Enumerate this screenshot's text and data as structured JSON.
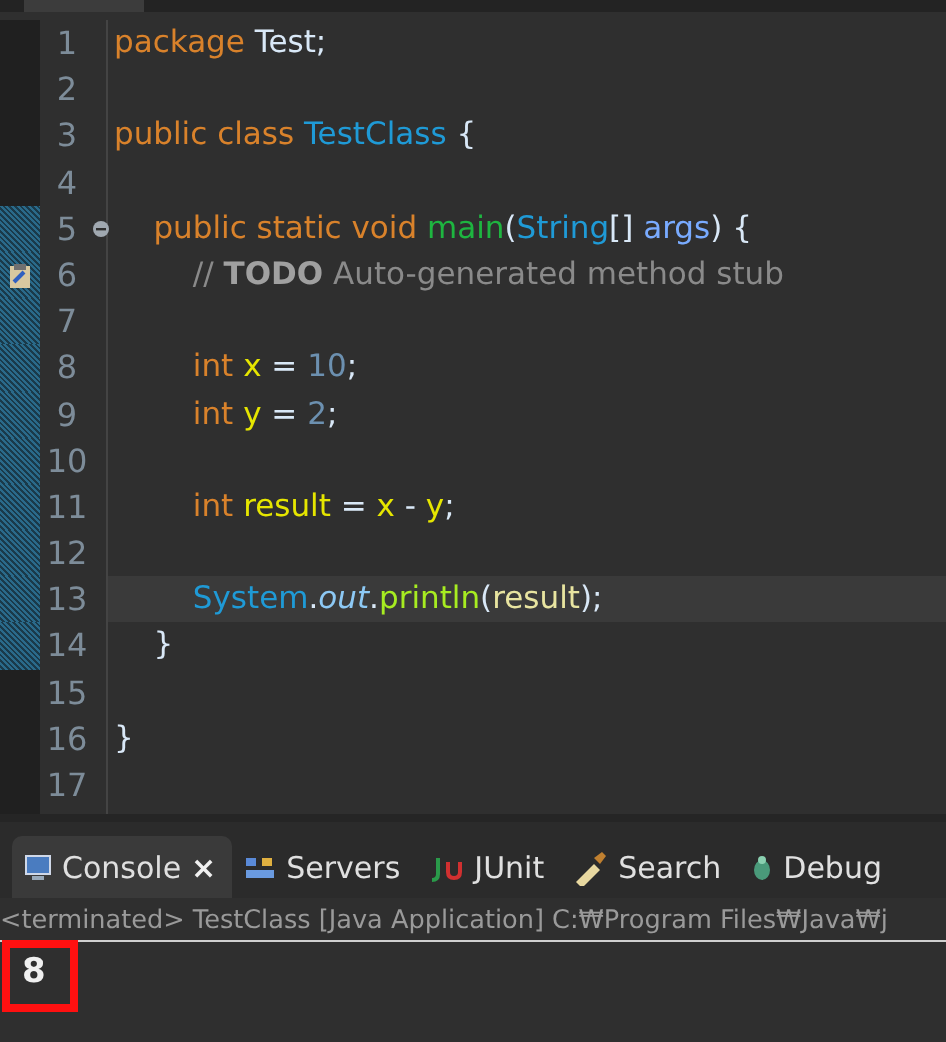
{
  "editor": {
    "lines": [
      {
        "number": "1",
        "tokens": [
          {
            "text": "package ",
            "kind": "keyword"
          },
          {
            "text": "Test;",
            "kind": "plain"
          }
        ]
      },
      {
        "number": "2"
      },
      {
        "number": "3",
        "tokens": [
          {
            "text": "public class ",
            "kind": "keyword"
          },
          {
            "text": "TestClass",
            "kind": "type"
          },
          {
            "text": " {",
            "kind": "plain"
          }
        ]
      },
      {
        "number": "4"
      },
      {
        "number": "5",
        "in_range": true,
        "fold": true,
        "tokens": [
          {
            "text": "    public static void ",
            "kind": "keyword"
          },
          {
            "text": "main",
            "kind": "method"
          },
          {
            "text": "(",
            "kind": "plain"
          },
          {
            "text": "String",
            "kind": "type"
          },
          {
            "text": "[] ",
            "kind": "plain"
          },
          {
            "text": "args",
            "kind": "param"
          },
          {
            "text": ") {",
            "kind": "plain"
          }
        ]
      },
      {
        "number": "6",
        "in_range": true,
        "annotation": true,
        "tokens": [
          {
            "text": "        // ",
            "kind": "comment"
          },
          {
            "text": "TODO",
            "kind": "todo"
          },
          {
            "text": " Auto-generated method stub",
            "kind": "comment"
          }
        ]
      },
      {
        "number": "7",
        "in_range": true
      },
      {
        "number": "8",
        "in_range": true,
        "tokens": [
          {
            "text": "        int ",
            "kind": "keyword"
          },
          {
            "text": "x",
            "kind": "local"
          },
          {
            "text": " = ",
            "kind": "plain"
          },
          {
            "text": "10",
            "kind": "number"
          },
          {
            "text": ";",
            "kind": "plain"
          }
        ]
      },
      {
        "number": "9",
        "in_range": true,
        "tokens": [
          {
            "text": "        int ",
            "kind": "keyword"
          },
          {
            "text": "y",
            "kind": "local"
          },
          {
            "text": " = ",
            "kind": "plain"
          },
          {
            "text": "2",
            "kind": "number"
          },
          {
            "text": ";",
            "kind": "plain"
          }
        ]
      },
      {
        "number": "10",
        "in_range": true
      },
      {
        "number": "11",
        "in_range": true,
        "tokens": [
          {
            "text": "        int ",
            "kind": "keyword"
          },
          {
            "text": "result",
            "kind": "local"
          },
          {
            "text": " = ",
            "kind": "plain"
          },
          {
            "text": "x",
            "kind": "local"
          },
          {
            "text": " - ",
            "kind": "plain"
          },
          {
            "text": "y",
            "kind": "local"
          },
          {
            "text": ";",
            "kind": "plain"
          }
        ]
      },
      {
        "number": "12",
        "in_range": true
      },
      {
        "number": "13",
        "current": true,
        "in_range": true,
        "tokens": [
          {
            "text": "        System",
            "kind": "type"
          },
          {
            "text": ".",
            "kind": "plain"
          },
          {
            "text": "out",
            "kind": "field"
          },
          {
            "text": ".",
            "kind": "plain"
          },
          {
            "text": "println",
            "kind": "call"
          },
          {
            "text": "(",
            "kind": "plain"
          },
          {
            "text": "result",
            "kind": "arg"
          },
          {
            "text": ");",
            "kind": "plain"
          }
        ]
      },
      {
        "number": "14",
        "in_range": true,
        "tokens": [
          {
            "text": "    }",
            "kind": "plain"
          }
        ]
      },
      {
        "number": "15"
      },
      {
        "number": "16",
        "tokens": [
          {
            "text": "}",
            "kind": "plain"
          }
        ]
      },
      {
        "number": "17"
      }
    ]
  },
  "console": {
    "tabs": [
      {
        "label": "Console",
        "kind": "console",
        "selected": true,
        "close": "×"
      },
      {
        "label": "Servers",
        "kind": "servers",
        "selected": false
      },
      {
        "label": "JUnit",
        "kind": "junit",
        "selected": false
      },
      {
        "label": "Search",
        "kind": "search",
        "selected": false
      },
      {
        "label": "Debug",
        "kind": "debug",
        "selected": false
      }
    ],
    "status": "<terminated> TestClass [Java Application] C:₩Program Files₩Java₩j",
    "output": "8"
  }
}
